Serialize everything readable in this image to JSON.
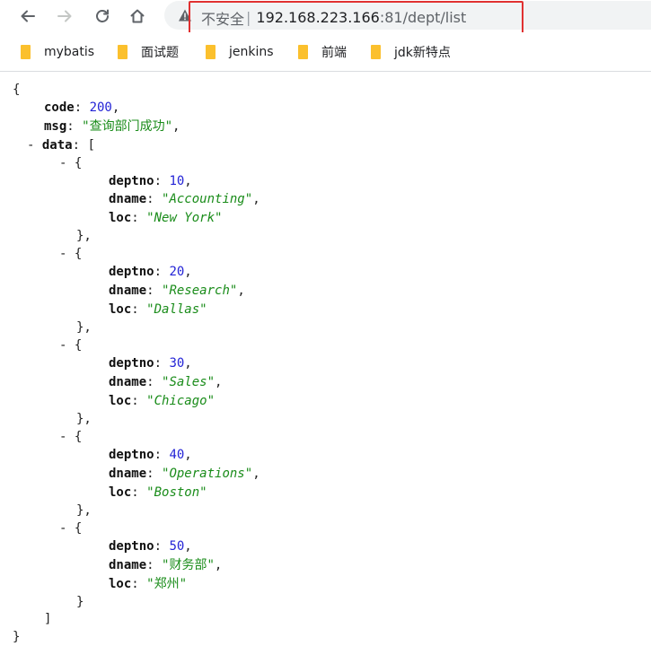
{
  "browser": {
    "security_label": "不安全",
    "separator": "|",
    "url_host": "192.168.223.166",
    "url_path": ":81/dept/list",
    "bookmarks": [
      {
        "label": "mybatis"
      },
      {
        "label": "面试题"
      },
      {
        "label": "jenkins"
      },
      {
        "label": "前端"
      },
      {
        "label": "jdk新特点"
      }
    ],
    "icons": {
      "back": "back-arrow-icon",
      "forward": "forward-arrow-icon",
      "reload": "reload-icon",
      "home": "home-icon",
      "warning": "warning-triangle-icon",
      "folder": "folder-icon"
    }
  },
  "json": {
    "toggle_symbol": "-",
    "code": {
      "key": "code",
      "value": "200"
    },
    "msg": {
      "key": "msg",
      "value": "查询部门成功"
    },
    "data_key": "data",
    "items": [
      {
        "deptno": "10",
        "dname": "Accounting",
        "loc": "New York"
      },
      {
        "deptno": "20",
        "dname": "Research",
        "loc": "Dallas"
      },
      {
        "deptno": "30",
        "dname": "Sales",
        "loc": "Chicago"
      },
      {
        "deptno": "40",
        "dname": "Operations",
        "loc": "Boston"
      },
      {
        "deptno": "50",
        "dname": "财务部",
        "loc": "郑州"
      }
    ],
    "field_keys": {
      "deptno": "deptno",
      "dname": "dname",
      "loc": "loc"
    }
  },
  "colors": {
    "number": "#2323d6",
    "string": "#1a8c1a",
    "highlight_box": "#e03131",
    "folder": "#fbc02d"
  }
}
